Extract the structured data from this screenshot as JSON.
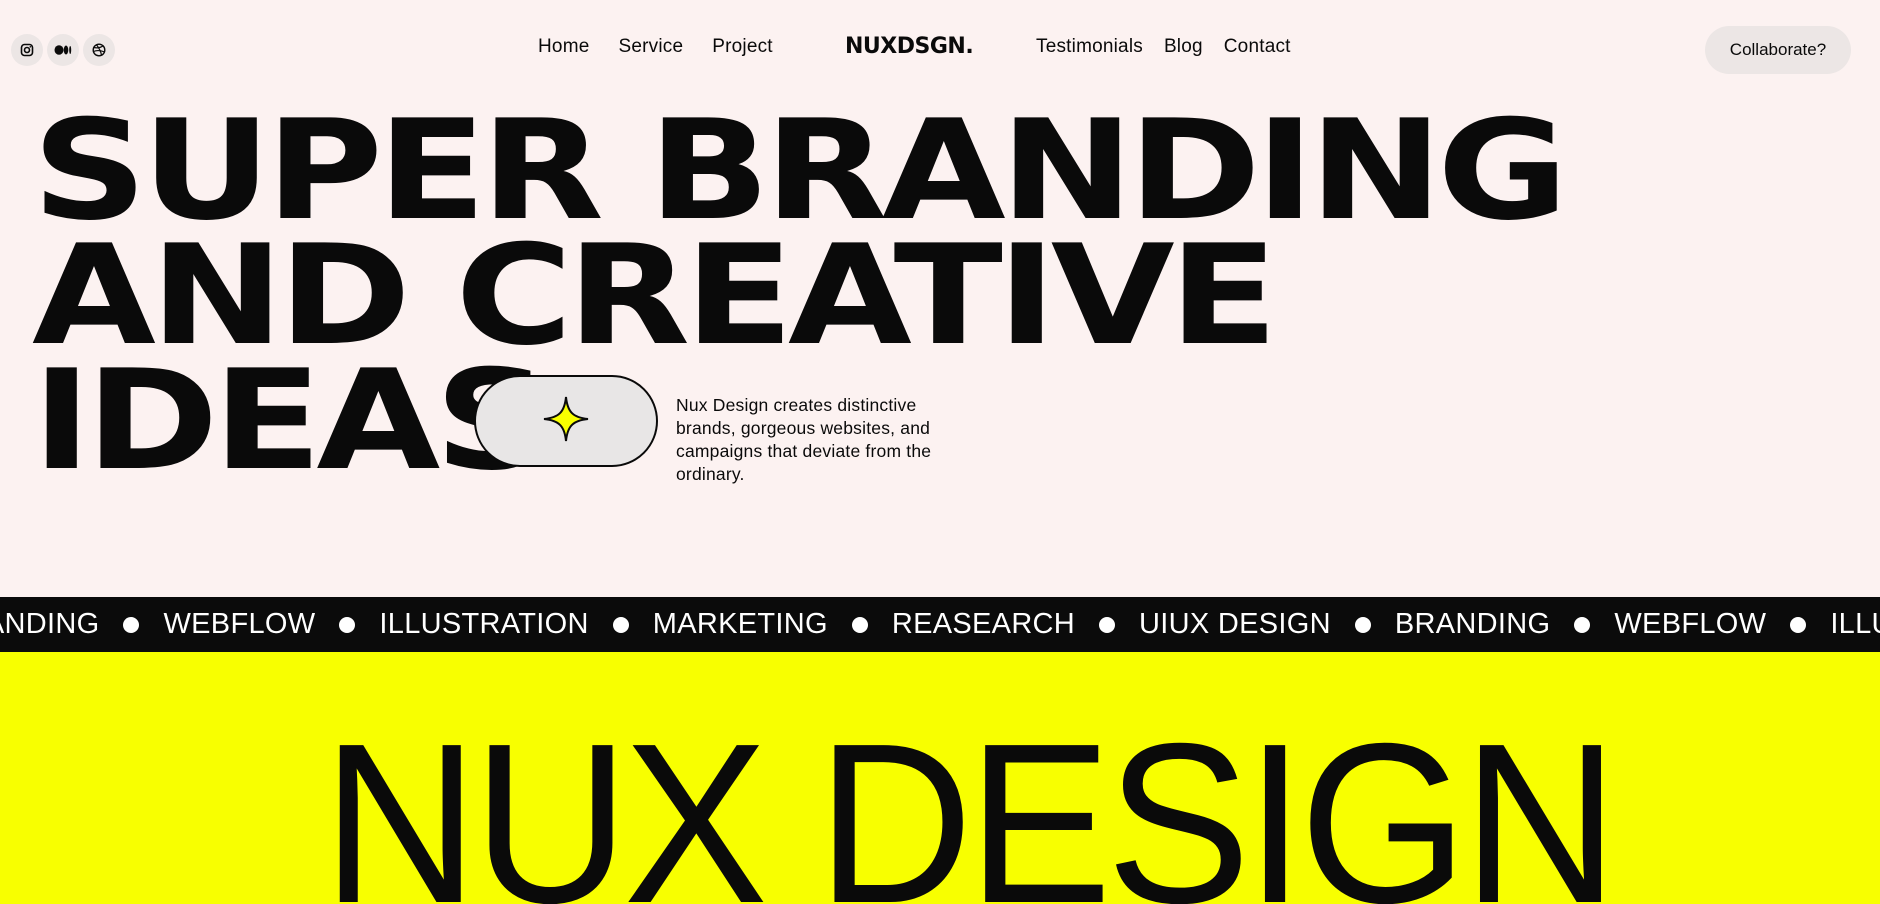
{
  "header": {
    "socials": [
      {
        "icon": "instagram-icon"
      },
      {
        "icon": "medium-icon"
      },
      {
        "icon": "dribbble-icon"
      }
    ],
    "nav_left": [
      "Home",
      "Service",
      "Project"
    ],
    "logo": "NUXDSGN.",
    "nav_right": [
      "Testimonials",
      "Blog",
      "Contact"
    ],
    "cta": "Collaborate?"
  },
  "hero": {
    "line1": "SUPER BRANDING",
    "line2": "AND CREATIVE",
    "line3": "IDEAS",
    "sparkle_icon": "sparkle-icon",
    "description": "Nux Design creates distinctive brands, gorgeous websites, and campaigns that deviate from the ordinary."
  },
  "marquee": {
    "items": [
      "BRANDING",
      "WEBFLOW",
      "ILLUSTRATION",
      "MARKETING",
      "REASEARCH",
      "UIUX DESIGN",
      "BRANDING",
      "WEBFLOW",
      "ILLUSTRATION"
    ]
  },
  "footer_brand": "NUX DESIGN",
  "colors": {
    "background": "#fcf2f1",
    "accent_yellow": "#f8ff00",
    "dark": "#0b0b0b"
  }
}
